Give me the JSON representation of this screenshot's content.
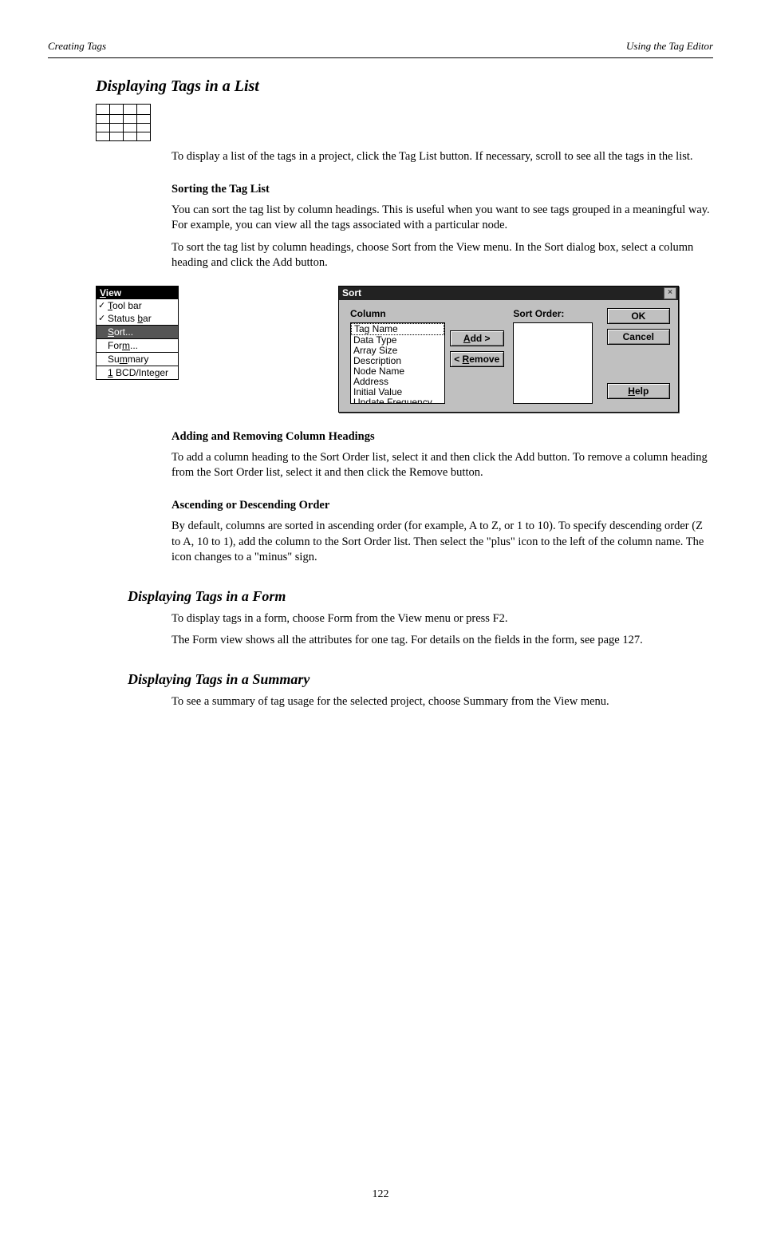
{
  "header": {
    "left": "Creating Tags",
    "right": "Using the Tag Editor"
  },
  "headings": {
    "main": "Displaying Tags in a List",
    "form": "Displaying Tags in a Form",
    "summary": "Displaying Tags in a Summary"
  },
  "paragraphs": {
    "p1": "To display a list of the tags in a project, click the Tag List button. If necessary, scroll to see all the tags in the list.",
    "p2": "You can sort the tag list by column headings. This is useful when you want to see tags grouped in a meaningful way. For example, you can view all the tags associated with a particular node.",
    "p3": "To sort the tag list by column headings, choose Sort from the View menu. In the Sort dialog box, select a column heading and click the Add button.",
    "p4": "To display tags in a form, choose Form from the View menu or press F2.",
    "p5": "The Form view shows all the attributes for one tag. For details on the fields in the form, see page 127.",
    "p6": "To see a summary of tag usage for the selected project, choose Summary from the View menu."
  },
  "subheadings": {
    "sort": "Sorting the Tag List",
    "add": "Adding and Removing Column Headings",
    "ascdesc": "Ascending or Descending Order"
  },
  "sub_paragraphs": {
    "add": "To add a column heading to the Sort Order list, select it and then click the Add button. To remove a column heading from the Sort Order list, select it and then click the Remove button.",
    "ascdesc": "By default, columns are sorted in ascending order (for example, A to Z, or 1 to 10). To specify descending order (Z to A, 10 to 1), add the column to the Sort Order list. Then select the \"plus\" icon to the left of the column name. The icon changes to a \"minus\" sign."
  },
  "viewmenu": {
    "title_pre": "V",
    "title_rest": "iew",
    "items": {
      "toolbar_pre": "T",
      "toolbar_rest": "ool bar",
      "statusbar_pre": "Status ",
      "statusbar_ul": "b",
      "statusbar_rest": "ar",
      "sort_pre": "S",
      "sort_rest": "ort...",
      "form_pre": "For",
      "form_ul": "m",
      "form_rest": "...",
      "summary_pre": "Su",
      "summary_ul": "m",
      "summary_rest": "mary",
      "bcd_pre": "1",
      "bcd_rest": " BCD/Integer"
    }
  },
  "sortdialog": {
    "title": "Sort",
    "column_label": "Column",
    "order_label": "Sort Order:",
    "list": {
      "i0": "Tag Name",
      "i1": "Data Type",
      "i2": "Array Size",
      "i3": "Description",
      "i4": "Node Name",
      "i5": "Address",
      "i6": "Initial Value",
      "i7": "Update Frequency"
    },
    "buttons": {
      "add_pre": "A",
      "add_rest": "dd >",
      "remove_pre": "< ",
      "remove_ul": "R",
      "remove_rest": "emove",
      "ok": "OK",
      "cancel": "Cancel",
      "help_pre": "H",
      "help_rest": "elp"
    }
  },
  "page_number": "122"
}
